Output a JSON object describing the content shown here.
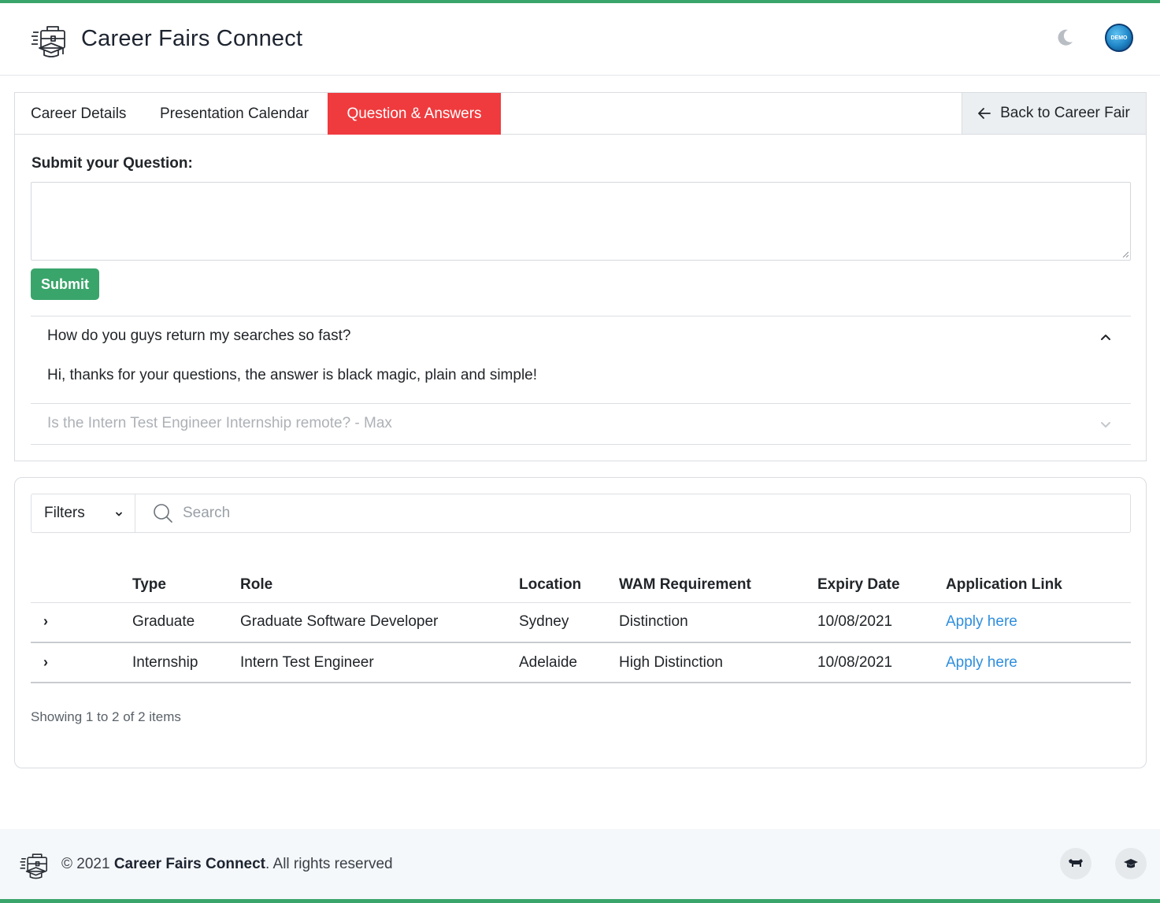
{
  "header": {
    "title": "Career Fairs Connect",
    "avatar_text": "DEMO",
    "icons": [
      "briefcase-logo-icon",
      "moon-icon"
    ]
  },
  "tabs": [
    {
      "label": "Career Details",
      "active": false
    },
    {
      "label": "Presentation Calendar",
      "active": false
    },
    {
      "label": "Question & Answers",
      "active": true
    }
  ],
  "back_button": {
    "label": "Back to Career Fair"
  },
  "question_form": {
    "label": "Submit your Question:",
    "value": "",
    "submit_label": "Submit"
  },
  "qa": [
    {
      "question": "How do you guys return my searches so fast?",
      "answer": "Hi, thanks for your questions, the answer is black magic, plain and simple!",
      "expanded": true
    },
    {
      "question": "Is the Intern Test Engineer Internship remote? - Max",
      "answer": "",
      "expanded": false
    }
  ],
  "filters": {
    "label": "Filters",
    "search_placeholder": "Search"
  },
  "table": {
    "columns": [
      "Type",
      "Role",
      "Location",
      "WAM Requirement",
      "Expiry Date",
      "Application Link"
    ],
    "rows": [
      {
        "type": "Graduate",
        "role": "Graduate Software Developer",
        "location": "Sydney",
        "wam": "Distinction",
        "expiry": "10/08/2021",
        "link": "Apply here"
      },
      {
        "type": "Internship",
        "role": "Intern Test Engineer",
        "location": "Adelaide",
        "wam": "High Distinction",
        "expiry": "10/08/2021",
        "link": "Apply here"
      }
    ],
    "expand_glyph": "›",
    "showing": "Showing 1 to 2 of 2 items"
  },
  "footer": {
    "copyright_prefix": "© 2021 ",
    "brand": "Career Fairs Connect",
    "copyright_suffix": ". All rights reserved"
  },
  "colors": {
    "accent_green": "#3aa56b",
    "active_tab_red": "#ef3b3e",
    "link_blue": "#2f8fde"
  }
}
